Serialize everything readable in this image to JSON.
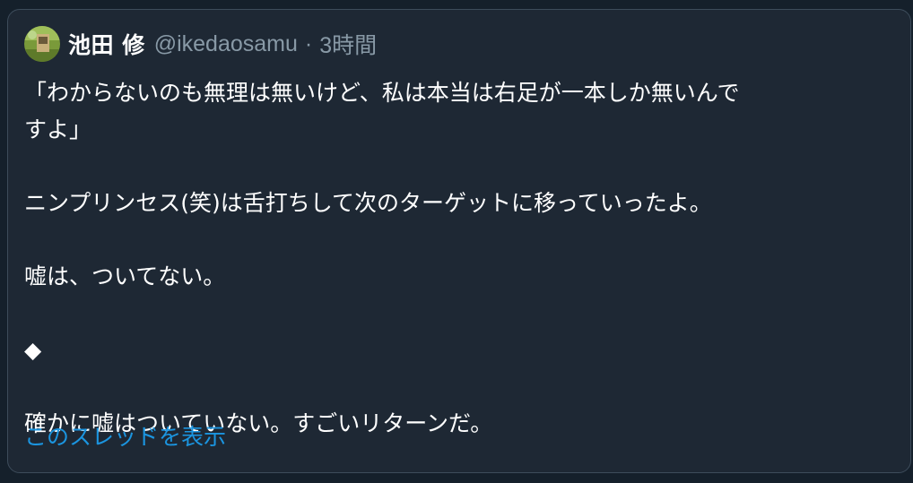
{
  "tweet": {
    "author_name": "池田 修",
    "handle": "@ikedaosamu",
    "separator": "·",
    "time": "3時間",
    "lines": [
      "「わからないのも無理は無いけど、私は本当は右足が一本しか無いんで",
      "すよ」",
      "",
      "ニンプリンセス(笑)は舌打ちして次のターゲットに移っていったよ。",
      "",
      "嘘は、ついてない。",
      "",
      "◆",
      "",
      "確かに嘘はついていない。すごいリターンだ。"
    ],
    "show_thread": "このスレッドを表示"
  },
  "colors": {
    "background": "#15202b",
    "card": "#1e2834",
    "border": "#3d4c5b",
    "text": "#ffffff",
    "muted": "#8899a6",
    "link": "#1b95e0"
  },
  "icons": {
    "avatar": "avatar-image"
  }
}
